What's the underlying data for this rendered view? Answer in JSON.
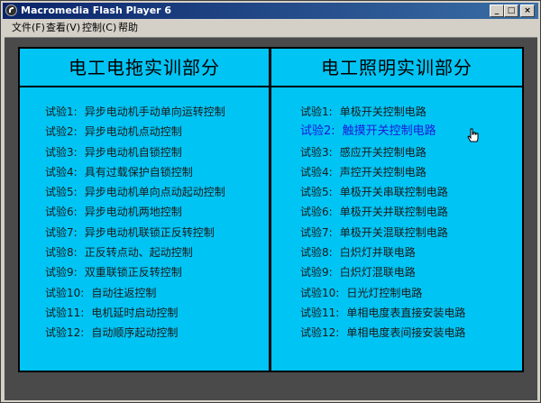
{
  "window": {
    "title": "Macromedia Flash Player 6",
    "controls": {
      "minimize": "_",
      "maximize": "□",
      "close": "×"
    }
  },
  "menubar": {
    "items": [
      "文件(F)",
      "查看(V)",
      "控制(C)",
      "帮助"
    ]
  },
  "left_panel": {
    "title": "电工电拖实训部分",
    "items": [
      {
        "label": "试验1:",
        "text": "异步电动机手动单向运转控制"
      },
      {
        "label": "试验2:",
        "text": "异步电动机点动控制"
      },
      {
        "label": "试验3:",
        "text": "异步电动机自锁控制"
      },
      {
        "label": "试验4:",
        "text": "具有过载保护自锁控制"
      },
      {
        "label": "试验5:",
        "text": "异步电动机单向点动起动控制"
      },
      {
        "label": "试验6:",
        "text": "异步电动机两地控制"
      },
      {
        "label": "试验7:",
        "text": "异步电动机联锁正反转控制"
      },
      {
        "label": "试验8:",
        "text": "正反转点动、起动控制"
      },
      {
        "label": "试验9:",
        "text": "双重联锁正反转控制"
      },
      {
        "label": "试验10:",
        "text": "自动往返控制"
      },
      {
        "label": "试验11:",
        "text": "电机延时启动控制"
      },
      {
        "label": "试验12:",
        "text": "自动顺序起动控制"
      }
    ]
  },
  "right_panel": {
    "title": "电工照明实训部分",
    "items": [
      {
        "label": "试验1:",
        "text": "单极开关控制电路"
      },
      {
        "label": "试验2:",
        "text": "触摸开关控制电路",
        "highlight": true
      },
      {
        "label": "试验3:",
        "text": "感应开关控制电路"
      },
      {
        "label": "试验4:",
        "text": "声控开关控制电路"
      },
      {
        "label": "试验5:",
        "text": "单极开关串联控制电路"
      },
      {
        "label": "试验6:",
        "text": "单极开关并联控制电路"
      },
      {
        "label": "试验7:",
        "text": "单极开关混联控制电路"
      },
      {
        "label": "试验8:",
        "text": "白炽灯并联电路"
      },
      {
        "label": "试验9:",
        "text": "白炽灯混联电路"
      },
      {
        "label": "试验10:",
        "text": "日光灯控制电路"
      },
      {
        "label": "试验11:",
        "text": "单相电度表直接安装电路"
      },
      {
        "label": "试验12:",
        "text": "单相电度表间接安装电路"
      }
    ]
  },
  "colors": {
    "panel_background": "#00c4f4",
    "highlight_text": "#1a1adc",
    "titlebar": "#0a246a"
  }
}
